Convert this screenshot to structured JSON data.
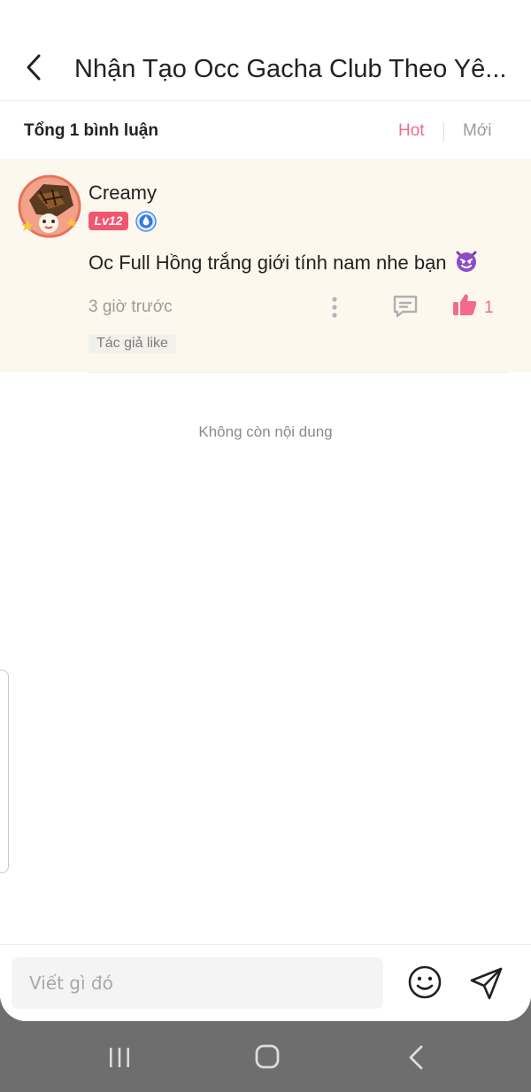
{
  "header": {
    "title": "Nhận Tạo Occ Gacha Club Theo Yê..."
  },
  "sortbar": {
    "total": "Tổng 1 bình luận",
    "hot": "Hot",
    "new": "Mới"
  },
  "comment": {
    "username": "Creamy",
    "level": "Lv12",
    "text": "Oc Full Hồng trắng giới tính nam nhe bạn",
    "emoji": "smiling-devil-emoji",
    "time": "3 giờ trước",
    "like_count": "1",
    "author_like_tag": "Tác giả like"
  },
  "feed": {
    "end_text": "Không còn nội dung"
  },
  "composer": {
    "placeholder": "Viết gì đó"
  },
  "colors": {
    "accent": "#f26b8a",
    "level_badge": "#f2566f",
    "comment_bg": "#fdf8ee",
    "nav_bg": "#6e6e6e"
  },
  "icons": {
    "back": "chevron-left-icon",
    "verify": "water-drop-badge-icon",
    "more": "vertical-dots-icon",
    "reply": "comment-bubble-icon",
    "like": "thumbs-up-icon",
    "emoji": "smiley-face-icon",
    "send": "paper-plane-icon",
    "nav_recent": "recent-apps-icon",
    "nav_home": "home-icon",
    "nav_back": "back-icon"
  }
}
